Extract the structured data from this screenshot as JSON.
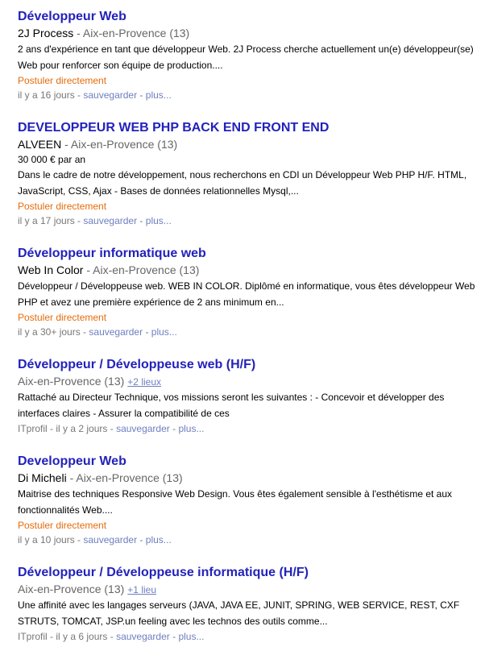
{
  "labels": {
    "apply": "Postuler directement",
    "sep": " - ",
    "save": "sauvegarder",
    "more": "plus..."
  },
  "jobs": [
    {
      "title": "Développeur Web",
      "company": "2J Process",
      "location": "Aix-en-Provence",
      "count": "(13)",
      "snippet": "2 ans d'expérience en tant que développeur Web. 2J Process cherche actuellement un(e) développeur(se) Web pour renforcer son équipe de production....",
      "age": "il y a 16 jours"
    },
    {
      "title": "DEVELOPPEUR WEB PHP BACK END FRONT END",
      "company": "ALVEEN",
      "location": "Aix-en-Provence",
      "count": "(13)",
      "salary": "30 000 € par an",
      "snippet": "Dans le cadre de notre développement, nous recherchons en CDI un Développeur Web PHP H/F. HTML, JavaScript, CSS, Ajax - Bases de données relationnelles Mysql,...",
      "age": "il y a 17 jours"
    },
    {
      "title": "Développeur informatique web",
      "company": "Web In Color",
      "location": "Aix-en-Provence",
      "count": "(13)",
      "snippet": "Développeur / Développeuse web. WEB IN COLOR. Diplômé en informatique, vous êtes développeur Web PHP et avez une première expérience de 2 ans minimum en...",
      "age": "il y a 30+ jours"
    },
    {
      "title": "Développeur / Développeuse web (H/F)",
      "location": "Aix-en-Provence",
      "count": "(13)",
      "more_locations": "+2 lieux",
      "snippet": "Rattaché au Directeur Technique, vos missions seront les suivantes : - Concevoir et développer des interfaces claires - Assurer la compatibilité de ces",
      "source": "ITprofil",
      "age": "il y a 2 jours"
    },
    {
      "title": "Developpeur Web",
      "company": "Di Micheli",
      "location": "Aix-en-Provence",
      "count": "(13)",
      "snippet": "Maitrise des techniques Responsive Web Design. Vous êtes également sensible à l'esthétisme et aux fonctionnalités Web....",
      "age": "il y a 10 jours"
    },
    {
      "title": "Développeur / Développeuse informatique (H/F)",
      "location": "Aix-en-Provence",
      "count": "(13)",
      "more_locations": "+1 lieu",
      "snippet": "Une affinité avec les langages serveurs (JAVA, JAVA EE, JUNIT, SPRING, WEB SERVICE, REST, CXF STRUTS, TOMCAT, JSP.un feeling avec les technos des outils comme...",
      "source": "ITprofil",
      "age": "il y a 6 jours"
    }
  ]
}
